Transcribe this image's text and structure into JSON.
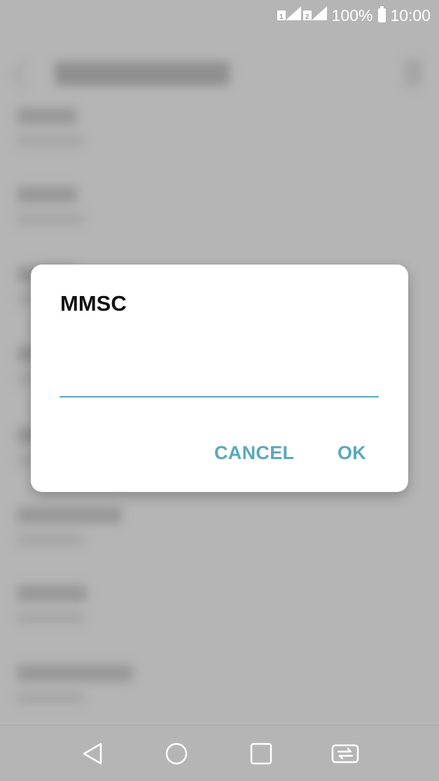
{
  "status_bar": {
    "sim1": "1",
    "sim2": "2",
    "battery_text": "100%",
    "time": "10:00"
  },
  "dialog": {
    "title": "MMSC",
    "input_value": "",
    "cancel_label": "CANCEL",
    "ok_label": "OK"
  },
  "nav": {
    "back": "back-icon",
    "home": "home-icon",
    "recents": "recents-icon",
    "switch": "dual-window-icon"
  },
  "colors": {
    "accent": "#5aa8bd",
    "scrim": "#b5b5b5"
  }
}
